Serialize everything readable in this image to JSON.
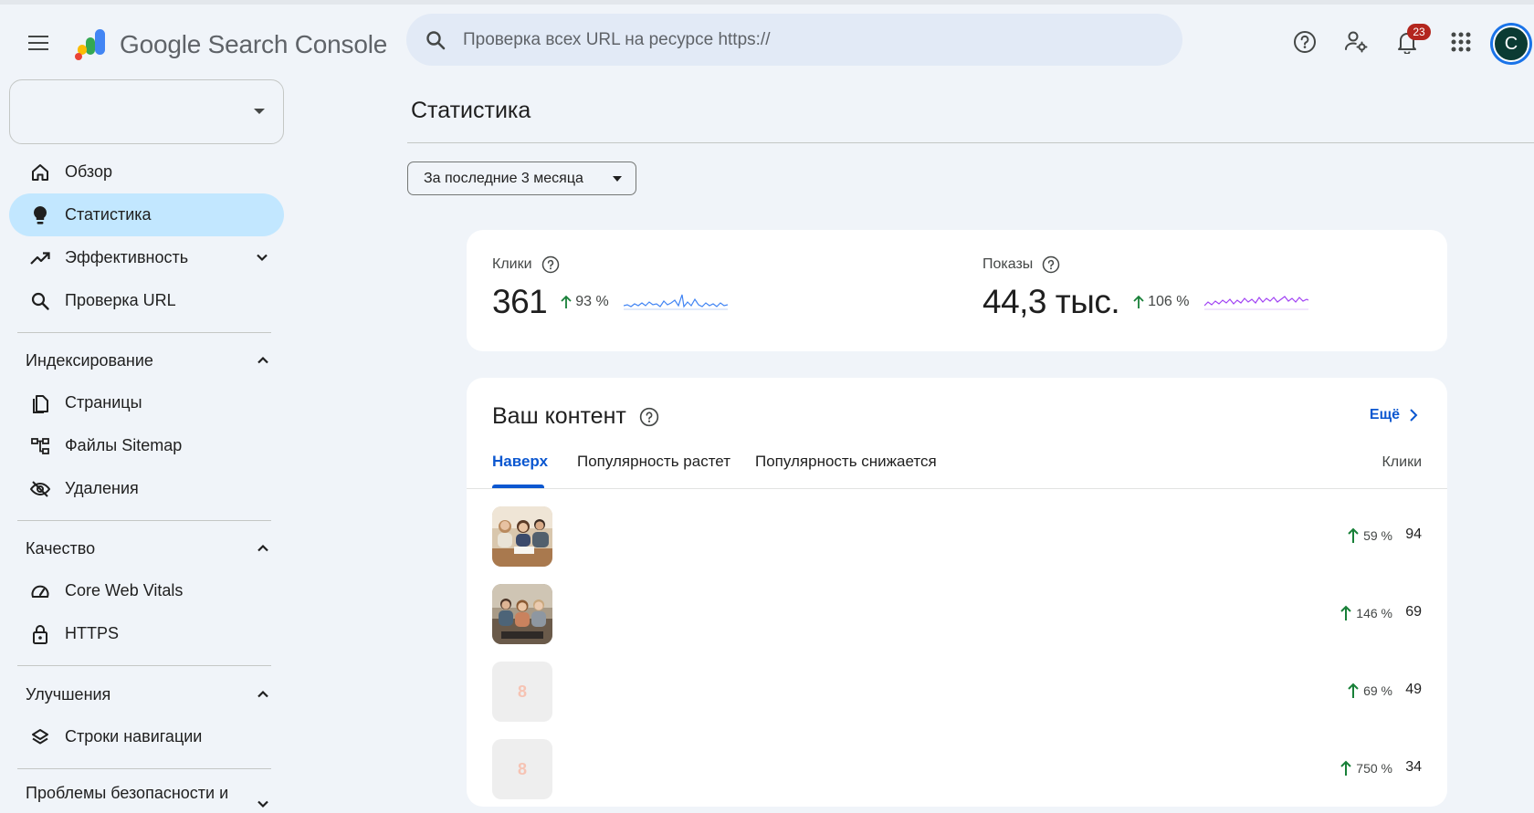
{
  "header": {
    "product_name": "Google Search Console",
    "search_placeholder": "Проверка всех URL на ресурсе https://",
    "notification_count": "23",
    "avatar_initial": "C"
  },
  "sidebar": {
    "property_value": "",
    "items": [
      {
        "label": "Обзор",
        "icon": "home-icon"
      },
      {
        "label": "Статистика",
        "icon": "lightbulb-icon",
        "active": true
      },
      {
        "label": "Эффективность",
        "icon": "trending-up-icon",
        "expandable": true
      },
      {
        "label": "Проверка URL",
        "icon": "search-icon"
      }
    ],
    "sections": [
      {
        "title": "Индексирование",
        "items": [
          {
            "label": "Страницы",
            "icon": "pages-icon"
          },
          {
            "label": "Файлы Sitemap",
            "icon": "sitemap-icon"
          },
          {
            "label": "Удаления",
            "icon": "eye-off-icon"
          }
        ]
      },
      {
        "title": "Качество",
        "items": [
          {
            "label": "Core Web Vitals",
            "icon": "speedometer-icon"
          },
          {
            "label": "HTTPS",
            "icon": "lock-icon"
          }
        ]
      },
      {
        "title": "Улучшения",
        "items": [
          {
            "label": "Строки навигации",
            "icon": "layers-icon"
          }
        ]
      },
      {
        "title": "Проблемы безопасности и"
      }
    ]
  },
  "main": {
    "title": "Статистика",
    "date_range": "За последние 3 месяца",
    "metrics": [
      {
        "label": "Клики",
        "value": "361",
        "change": "93 %",
        "color": "#4285f4"
      },
      {
        "label": "Показы",
        "value": "44,3 тыс.",
        "change": "106 %",
        "color": "#a142f4"
      }
    ],
    "content": {
      "title": "Ваш контент",
      "more_label": "Ещё",
      "tabs": [
        "Наверх",
        "Популярность растет",
        "Популярность снижается"
      ],
      "column_header": "Клики",
      "rows": [
        {
          "thumb": "photo-family",
          "change": "59 %",
          "value": "94"
        },
        {
          "thumb": "photo-couch",
          "change": "146 %",
          "value": "69"
        },
        {
          "thumb": "placeholder",
          "thumb_letter": "8",
          "change": "69 %",
          "value": "49"
        },
        {
          "thumb": "placeholder",
          "thumb_letter": "8",
          "change": "750 %",
          "value": "34"
        }
      ]
    }
  },
  "colors": {
    "accent": "#0b57d0",
    "active_nav": "#c2e7ff",
    "positive": "#188038",
    "page_bg": "#f0f4f9"
  }
}
